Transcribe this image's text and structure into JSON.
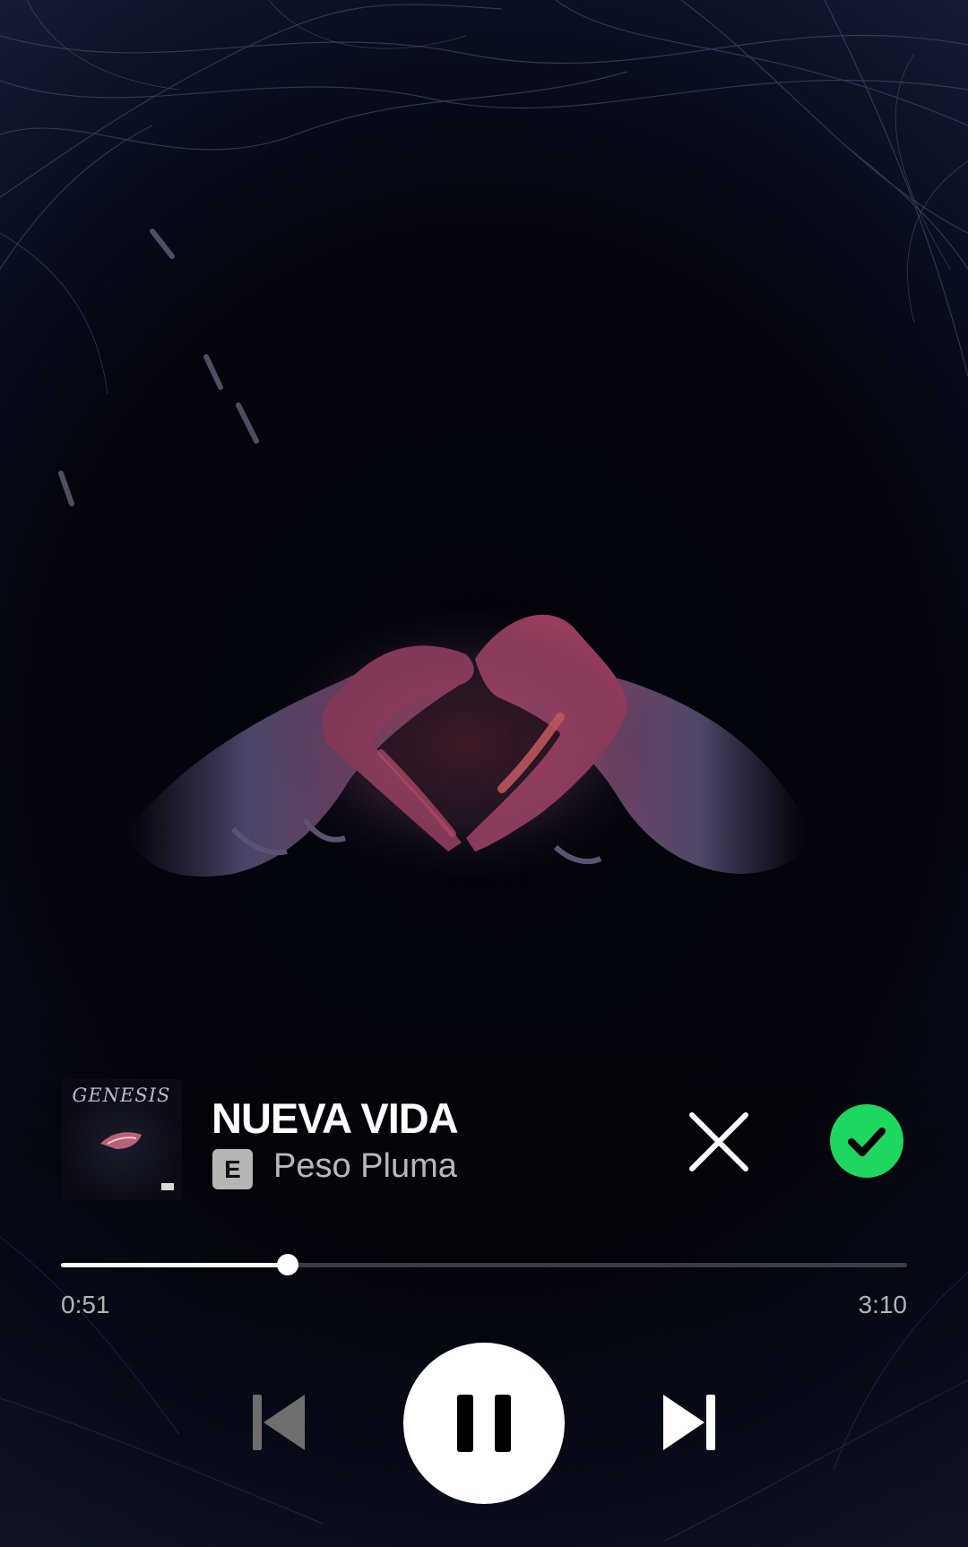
{
  "canvas": {
    "artwork": "heart-hands-video-canvas"
  },
  "track": {
    "album_cover_text": "GENESIS",
    "title": "NUEVA VIDA",
    "explicit_badge": "E",
    "artist": "Peso Pluma",
    "saved": true
  },
  "playback": {
    "elapsed": "0:51",
    "duration": "3:10",
    "progress_fraction": 0.268,
    "state": "playing"
  },
  "icons": {
    "dismiss": "close-icon",
    "saved": "check-icon",
    "previous": "skip-previous-icon",
    "play_pause": "pause-icon",
    "next": "skip-next-icon"
  },
  "colors": {
    "accent_green": "#1ed760",
    "background": "#03040a",
    "text_primary": "#ffffff",
    "text_secondary": "#b3b3b3"
  }
}
